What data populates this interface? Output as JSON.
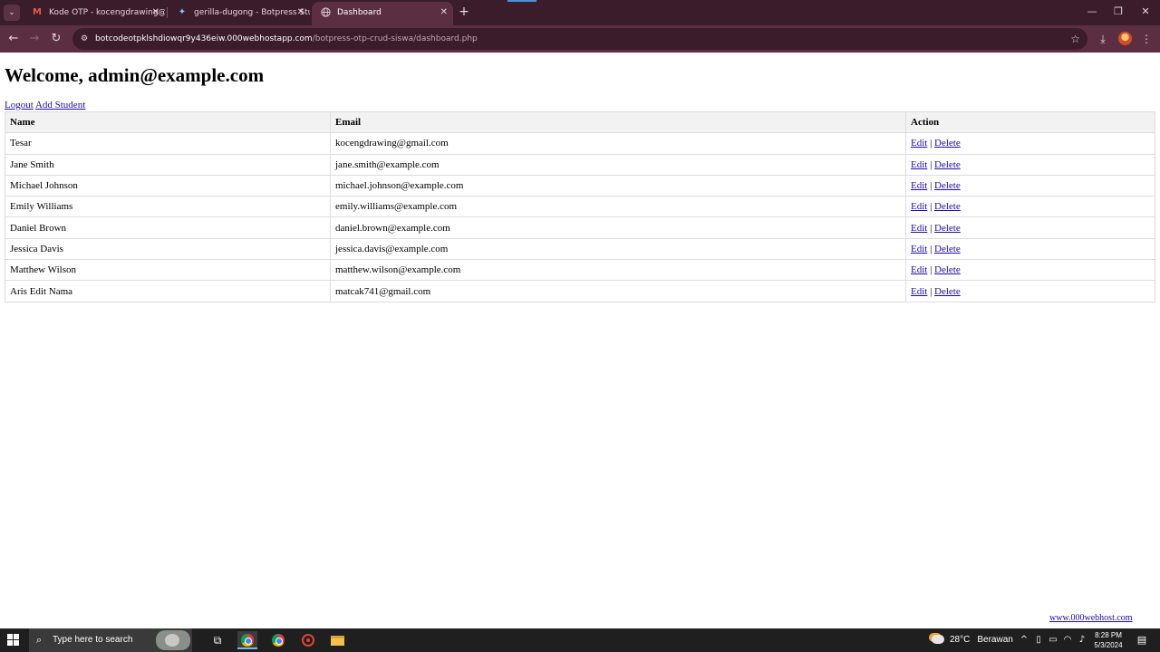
{
  "browser": {
    "tabs": [
      {
        "title": "Kode OTP - kocengdrawing@g",
        "icon": "gmail-icon"
      },
      {
        "title": "gerilla-dugong - Botpress Studi",
        "icon": "botpress-icon"
      },
      {
        "title": "Dashboard",
        "icon": "globe-icon",
        "active": true
      }
    ],
    "url_host": "botcodeotpklshdiowqr9y436eiw.000webhostapp.com",
    "url_path": "/botpress-otp-crud-siswa/dashboard.php"
  },
  "page": {
    "welcome": "Welcome, admin@example.com",
    "logout_label": "Logout",
    "add_student_label": "Add Student",
    "table": {
      "headers": {
        "name": "Name",
        "email": "Email",
        "action": "Action"
      },
      "edit_label": "Edit",
      "separator": "|",
      "delete_label": "Delete",
      "rows": [
        {
          "name": "Tesar",
          "email": "kocengdrawing@gmail.com"
        },
        {
          "name": "Jane Smith",
          "email": "jane.smith@example.com"
        },
        {
          "name": "Michael Johnson",
          "email": "michael.johnson@example.com"
        },
        {
          "name": "Emily Williams",
          "email": "emily.williams@example.com"
        },
        {
          "name": "Daniel Brown",
          "email": "daniel.brown@example.com"
        },
        {
          "name": "Jessica Davis",
          "email": "jessica.davis@example.com"
        },
        {
          "name": "Matthew Wilson",
          "email": "matthew.wilson@example.com"
        },
        {
          "name": "Aris Edit Nama",
          "email": "matcak741@gmail.com"
        }
      ]
    },
    "footer_badge": "www.000webhost.com"
  },
  "taskbar": {
    "search_placeholder": "Type here to search",
    "weather_temp": "28°C",
    "weather_condition": "Berawan",
    "time": "8:28 PM",
    "date": "5/3/2024"
  }
}
